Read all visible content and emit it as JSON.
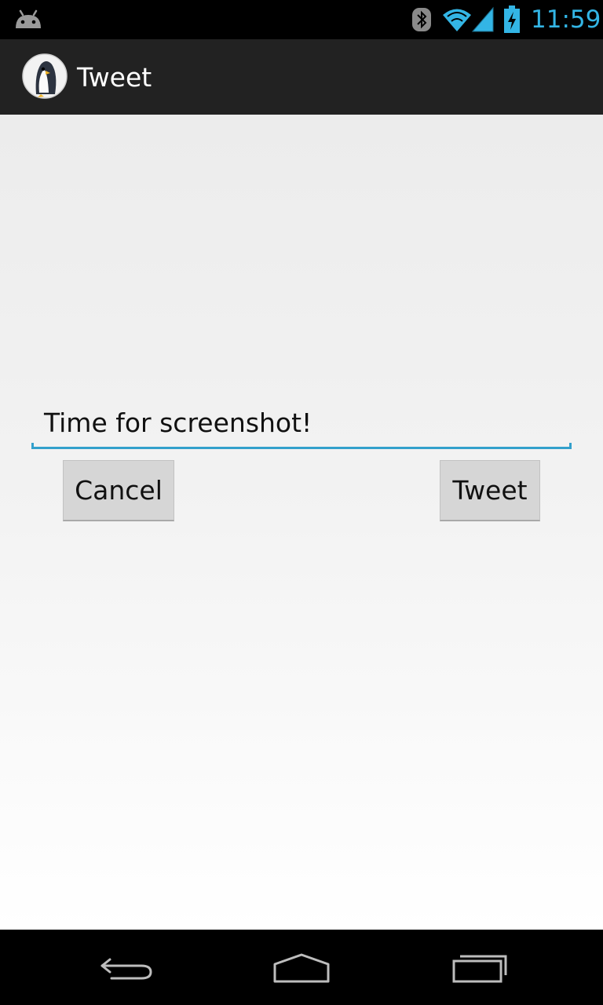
{
  "status_bar": {
    "time": "11:59",
    "accent_color": "#33b5e5",
    "icons": [
      "android-notification-icon",
      "bluetooth-icon",
      "wifi-icon",
      "signal-icon",
      "battery-charging-icon"
    ]
  },
  "action_bar": {
    "app_icon": "penguin-app-icon",
    "title": "Tweet"
  },
  "compose": {
    "input_value": "Time for screenshot!",
    "focus_color": "#33a0cc"
  },
  "buttons": {
    "cancel_label": "Cancel",
    "tweet_label": "Tweet"
  },
  "nav_bar": {
    "icons": [
      "back-icon",
      "home-icon",
      "recents-icon"
    ]
  }
}
